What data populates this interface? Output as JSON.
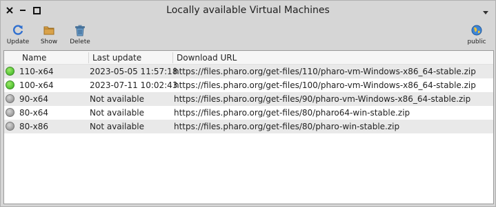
{
  "window": {
    "title": "Locally available Virtual Machines"
  },
  "toolbar": {
    "update_label": "Update",
    "show_label": "Show",
    "delete_label": "Delete",
    "public_label": "public"
  },
  "table": {
    "columns": [
      "Name",
      "Last update",
      "Download URL"
    ],
    "rows": [
      {
        "name": "110-x64",
        "last_update": "2023-05-05 11:57:18",
        "url": "https://files.pharo.org/get-files/110/pharo-vm-Windows-x86_64-stable.zip",
        "status": "green"
      },
      {
        "name": "100-x64",
        "last_update": "2023-07-11 10:02:43",
        "url": "https://files.pharo.org/get-files/100/pharo-vm-Windows-x86_64-stable.zip",
        "status": "green"
      },
      {
        "name": "90-x64",
        "last_update": "Not available",
        "url": "https://files.pharo.org/get-files/90/pharo-vm-Windows-x86_64-stable.zip",
        "status": "gray"
      },
      {
        "name": "80-x64",
        "last_update": "Not available",
        "url": "https://files.pharo.org/get-files/80/pharo64-win-stable.zip",
        "status": "gray"
      },
      {
        "name": "80-x86",
        "last_update": "Not available",
        "url": "https://files.pharo.org/get-files/80/pharo-win-stable.zip",
        "status": "gray"
      }
    ]
  },
  "colors": {
    "available": "#5bc83a",
    "unavailable": "#a6a6a6"
  }
}
